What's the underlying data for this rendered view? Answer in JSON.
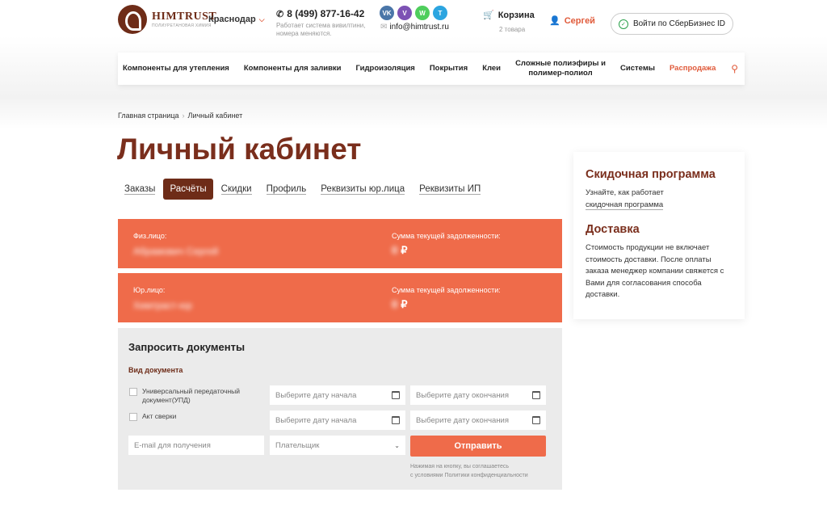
{
  "header": {
    "logo_name": "HIMTRUST",
    "logo_sub": "ПОЛИУРЕТАНОВАЯ ХИМИЯ",
    "city": "Краснодар",
    "phone": "8 (499) 877-16-42",
    "phone_note": "Работает система вивилтини, номера меняются.",
    "email": "info@himtrust.ru",
    "socials": [
      {
        "name": "vk",
        "label": "VK",
        "color": "#4a76a8"
      },
      {
        "name": "viber",
        "label": "V",
        "color": "#7d52b4"
      },
      {
        "name": "whatsapp",
        "label": "W",
        "color": "#4fce5d"
      },
      {
        "name": "telegram",
        "label": "T",
        "color": "#2ca5e0"
      }
    ],
    "cart_label": "Корзина",
    "cart_count": "2 товара",
    "user_name": "Сергей",
    "sber_label": "Войти по СберБизнес ID"
  },
  "nav": {
    "items": [
      "Компоненты для утепления",
      "Компоненты для заливки",
      "Гидроизоляция",
      "Покрытия",
      "Клеи",
      "Сложные полиэфиры и полимер-полиол",
      "Системы"
    ],
    "sale": "Распродажа"
  },
  "breadcrumb": {
    "home": "Главная страница",
    "current": "Личный кабинет"
  },
  "page_title": "Личный кабинет",
  "tabs": [
    "Заказы",
    "Расчёты",
    "Скидки",
    "Профиль",
    "Реквизиты юр.лица",
    "Реквизиты ИП"
  ],
  "active_tab": "Расчёты",
  "debts": [
    {
      "type": "Физ.лицо:",
      "name": "Абрамович Сергей",
      "sum_label": "Сумма текущей задолженности:",
      "sum": "0",
      "currency": "₽"
    },
    {
      "type": "Юр.лицо:",
      "name": "Химтраст-юр",
      "sum_label": "Сумма текущей задолженности:",
      "sum": "0",
      "currency": "₽"
    }
  ],
  "request": {
    "title": "Запросить документы",
    "doc_type_label": "Вид документа",
    "docs": [
      "Универсальный передаточный документ(УПД)",
      "Акт сверки"
    ],
    "date_start_placeholder": "Выберите дату начала",
    "date_end_placeholder": "Выберите дату окончания",
    "email_placeholder": "E-mail для получения",
    "payer_placeholder": "Плательщик",
    "send_label": "Отправить",
    "consent_line1": "Нажимая на кнопку, вы соглашаетесь",
    "consent_line2": "с условиями Политики конфиденциальности"
  },
  "side": {
    "discount_title": "Скидочная программа",
    "discount_text": "Узнайте, как работает",
    "discount_link": "скидочная программа",
    "delivery_title": "Доставка",
    "delivery_text": "Стоимость продукции не включает стоимость доставки. После оплаты заказа менеджер компании свяжется с Вами для согласования способа доставки."
  },
  "colors": {
    "accent": "#ef6b4a",
    "brand": "#6e2c18",
    "title": "#7a2e1c"
  }
}
